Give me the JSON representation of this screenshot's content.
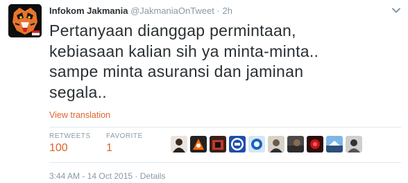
{
  "tweet": {
    "fullname": "Infokom Jakmania",
    "username": "@JakmaniaOnTweet",
    "separator": "·",
    "time_ago": "2h",
    "text": "Pertanyaan dianggap permintaan,\nkebiasaan kalian sih ya minta-minta..\nsampe minta asuransi dan jaminan\nsegala..",
    "view_translation": "View translation"
  },
  "stats": {
    "retweets_label": "RETWEETS",
    "retweets_value": "100",
    "favorites_label": "FAVORITE",
    "favorites_value": "1"
  },
  "footer": {
    "timestamp": "3:44 AM - 14 Oct 2015",
    "separator": "·",
    "details": "Details"
  },
  "colors": {
    "accent": "#e0622f",
    "muted": "#8899a6",
    "text": "#292f33"
  },
  "icons": {
    "profile_avatar": "tiger-logo-avatar",
    "more": "chevron-down-icon"
  }
}
